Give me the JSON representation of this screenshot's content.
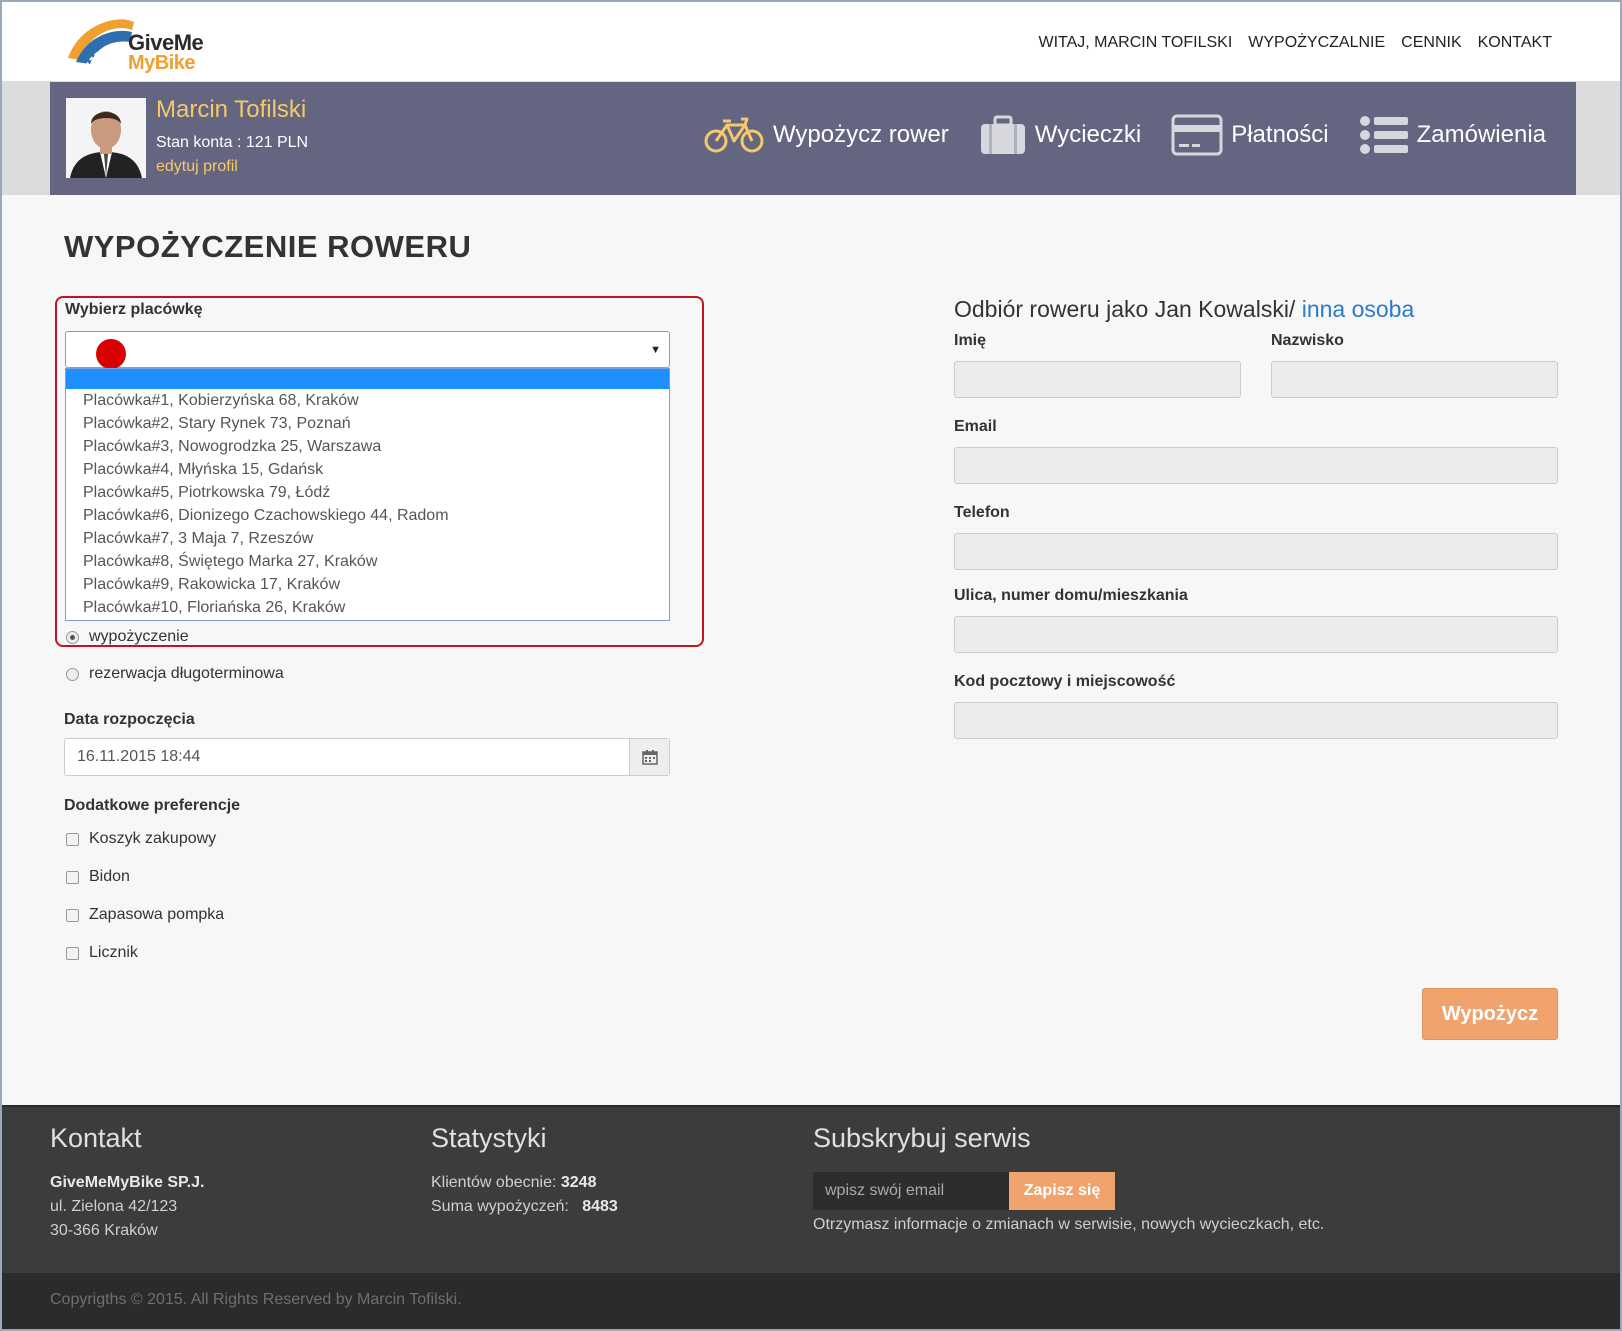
{
  "brand": {
    "line1": "GiveMe",
    "line2": "MyBike"
  },
  "topnav": [
    "WITAJ, MARCIN TOFILSKI",
    "WYPOŻYCZALNIE",
    "CENNIK",
    "KONTAKT"
  ],
  "user": {
    "name": "Marcin Tofilski",
    "balance": "Stan konta : 121 PLN",
    "edit": "edytuj profil"
  },
  "bandnav": {
    "rent": "Wypożycz rower",
    "trips": "Wycieczki",
    "payments": "Płatności",
    "orders": "Zamówienia"
  },
  "page": {
    "title": "WYPOŻYCZENIE ROWERU"
  },
  "branch": {
    "label": "Wybierz placówkę",
    "options": [
      "Placówka#1, Kobierzyńska 68, Kraków",
      "Placówka#2, Stary Rynek 73, Poznań",
      "Placówka#3, Nowogrodzka 25, Warszawa",
      "Placówka#4, Młyńska 15, Gdańsk",
      "Placówka#5, Piotrkowska 79, Łódź",
      "Placówka#6, Dionizego Czachowskiego 44, Radom",
      "Placówka#7, 3 Maja 7, Rzeszów",
      "Placówka#8, Świętego Marka 27, Kraków",
      "Placówka#9, Rakowicka 17, Kraków",
      "Placówka#10, Floriańska 26, Kraków"
    ]
  },
  "rental_type": {
    "option1": "wypożyczenie",
    "option2": "rezerwacja długoterminowa"
  },
  "start_date": {
    "label": "Data rozpoczęcia",
    "value": "16.11.2015 18:44"
  },
  "prefs": {
    "label": "Dodatkowe preferencje",
    "items": [
      "Koszyk zakupowy",
      "Bidon",
      "Zapasowa pompka",
      "Licznik"
    ]
  },
  "pickup": {
    "title": "Odbiór roweru jako Jan Kowalski/ ",
    "other": "inna osoba",
    "first_name": "Imię",
    "last_name": "Nazwisko",
    "email": "Email",
    "phone": "Telefon",
    "street": "Ulica, numer domu/mieszkania",
    "postal": "Kod pocztowy i miejscowość"
  },
  "submit": "Wypożycz",
  "footer": {
    "contact_title": "Kontakt",
    "company": "GiveMeMyBike SP.J.",
    "address1": "ul. Zielona 42/123",
    "address2": "30-366 Kraków",
    "stats_title": "Statystyki",
    "clients_label": "Klientów obecnie:",
    "clients_value": "3248",
    "rentals_label": "Suma wypożyczeń:",
    "rentals_value": "8483",
    "subscribe_title": "Subskrybuj serwis",
    "email_placeholder": "wpisz swój email",
    "subscribe_btn": "Zapisz się",
    "subscribe_info": "Otrzymasz informacje o zmianach w serwisie, nowych wycieczkach, etc."
  },
  "copyright": "Copyrigths © 2015. All Rights Reserved by Marcin Tofilski.",
  "colors": {
    "band": "#646580",
    "accent": "#f5c86a",
    "button": "#f0a36c",
    "highlight": "#c4131d",
    "link": "#2b7bcb"
  }
}
